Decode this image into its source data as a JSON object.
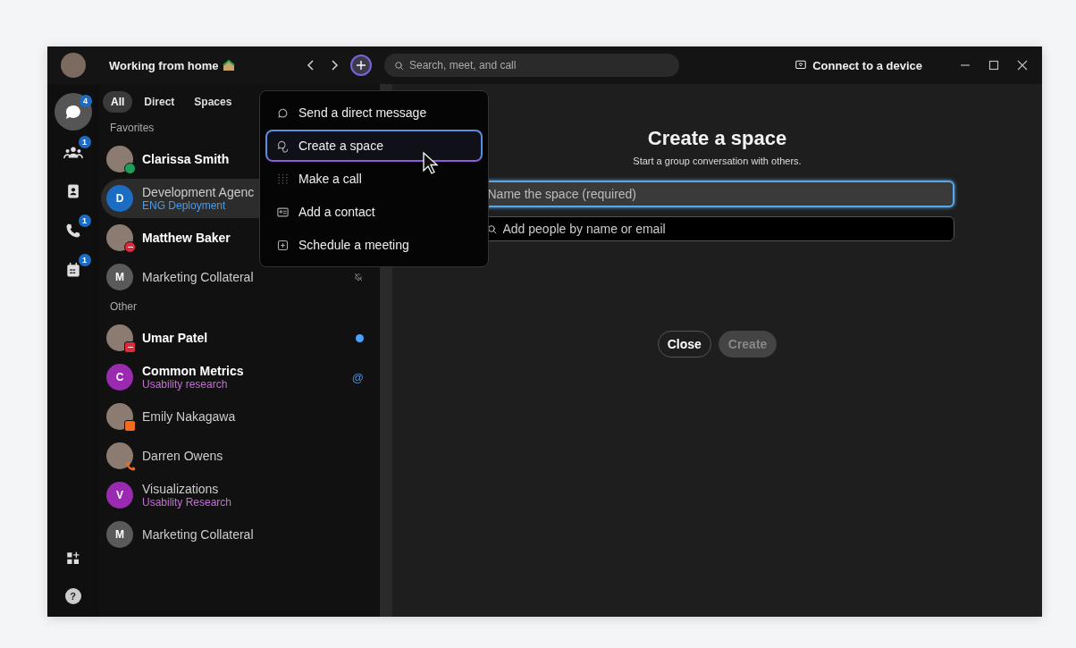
{
  "title_bar": {
    "status": "Working from home",
    "search": {
      "placeholder": "Search, meet, and call"
    },
    "connect": "Connect to a device"
  },
  "rail": [
    {
      "kind": "messaging",
      "badge": "4",
      "selected": true
    },
    {
      "kind": "teams",
      "badge": "1",
      "selected": false
    },
    {
      "kind": "contacts",
      "selected": false
    },
    {
      "kind": "calling",
      "badge": "1",
      "selected": false
    },
    {
      "kind": "meetings",
      "badge": "1",
      "selected": false
    }
  ],
  "help": {
    "label": "?"
  },
  "filters": [
    {
      "label": "All",
      "selected": true
    },
    {
      "label": "Direct",
      "selected": false
    },
    {
      "label": "Spaces",
      "selected": false
    }
  ],
  "sections": [
    {
      "title": "Favorites",
      "items": [
        {
          "name": "Clarissa Smith",
          "avatar": {
            "kind": "photo"
          },
          "presence": {
            "kind": "available"
          },
          "bold": true,
          "selected": false
        },
        {
          "name": "Development Agenc",
          "subtitle": "ENG Deployment",
          "avatar": {
            "kind": "letter",
            "letter": "D",
            "color": "#1d6cc4"
          },
          "bold": false,
          "selected": true
        },
        {
          "name": "Matthew Baker",
          "avatar": {
            "kind": "photo"
          },
          "presence": {
            "kind": "busy"
          },
          "bold": true,
          "selected": false
        },
        {
          "name": "Marketing Collateral",
          "avatar": {
            "kind": "letter",
            "letter": "M",
            "color": "#5a5a5a"
          },
          "indicator": {
            "kind": "muted"
          },
          "bold": false,
          "selected": false
        }
      ]
    },
    {
      "title": "Other",
      "items": [
        {
          "name": "Umar Patel",
          "avatar": {
            "kind": "photo"
          },
          "presence": {
            "kind": "presenting"
          },
          "indicator": {
            "kind": "unread"
          },
          "bold": true,
          "selected": false
        },
        {
          "name": "Common Metrics",
          "subtitle": "Usability research",
          "avatar": {
            "kind": "letter",
            "letter": "C",
            "color": "#9a2bb0"
          },
          "indicator": {
            "kind": "mention",
            "text": "@"
          },
          "bold": true,
          "selected": false
        },
        {
          "name": "Emily Nakagawa",
          "avatar": {
            "kind": "photo"
          },
          "presence": {
            "kind": "meeting"
          },
          "bold": false,
          "selected": false
        },
        {
          "name": "Darren Owens",
          "avatar": {
            "kind": "photo"
          },
          "presence": {
            "kind": "call"
          },
          "bold": false,
          "selected": false
        },
        {
          "name": "Visualizations",
          "subtitle": "Usability Research",
          "avatar": {
            "kind": "letter",
            "letter": "V",
            "color": "#9a2bb0"
          },
          "bold": false,
          "selected": false
        },
        {
          "name": "Marketing Collateral",
          "avatar": {
            "kind": "letter",
            "letter": "M",
            "color": "#5a5a5a"
          },
          "bold": false,
          "selected": false
        }
      ]
    }
  ],
  "menu": [
    {
      "kind": "message",
      "label": "Send a direct message",
      "selected": false
    },
    {
      "kind": "space",
      "label": "Create a space",
      "selected": true
    },
    {
      "kind": "call",
      "label": "Make a call",
      "selected": false
    },
    {
      "kind": "contact",
      "label": "Add a contact",
      "selected": false
    },
    {
      "kind": "meeting",
      "label": "Schedule a meeting",
      "selected": false
    }
  ],
  "dialog": {
    "title": "Create a space",
    "subtitle": "Start a group conversation with others.",
    "name_field": {
      "placeholder": "Name the space (required)"
    },
    "people_field": {
      "placeholder": "Add people by name or email"
    },
    "buttons": [
      {
        "label": "Close",
        "disabled": false
      },
      {
        "label": "Create",
        "disabled": true
      }
    ]
  }
}
